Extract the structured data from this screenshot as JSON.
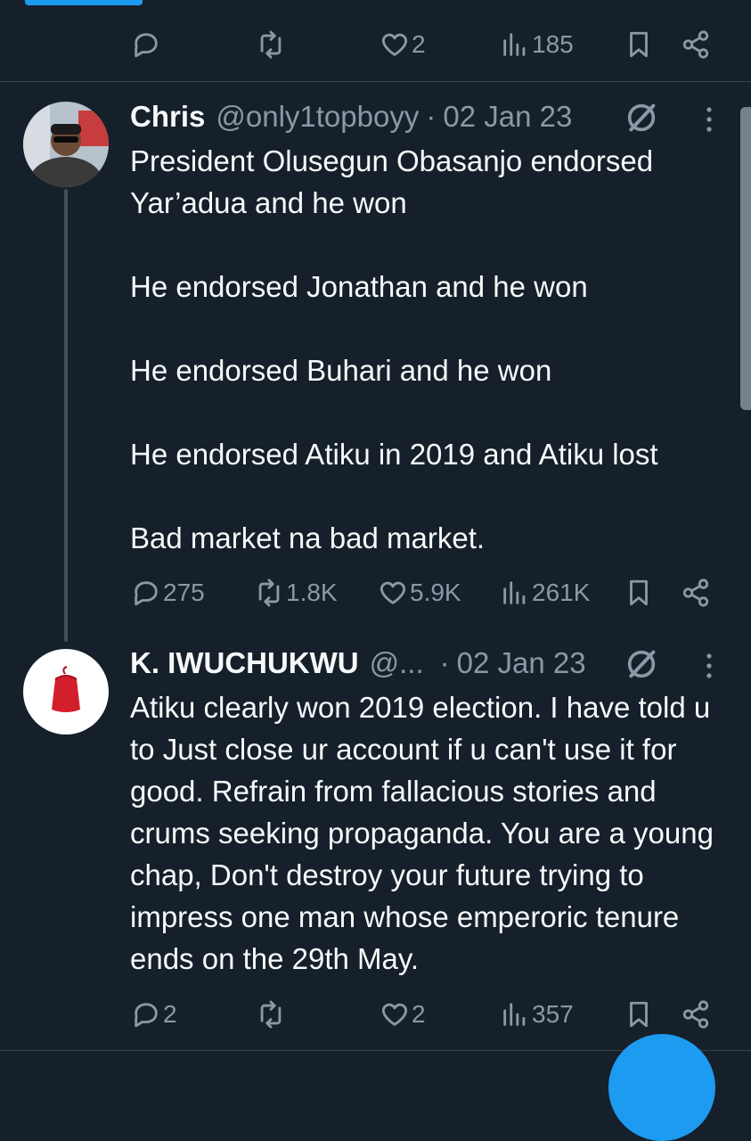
{
  "top_tweet_actions": {
    "reply_count": "",
    "retweet_count": "",
    "like_count": "2",
    "view_count": "185"
  },
  "tweets": [
    {
      "name": "Chris",
      "handle": "@only1topboyy",
      "separator": "·",
      "date": "02 Jan 23",
      "text": "President Olusegun Obasanjo endorsed Yar’adua and he won\n\nHe endorsed Jonathan and he won\n\nHe endorsed Buhari and he won\n\nHe endorsed Atiku in 2019 and Atiku lost\n\nBad market na bad market.",
      "reply_count": "275",
      "retweet_count": "1.8K",
      "like_count": "5.9K",
      "view_count": "261K"
    },
    {
      "name": "K. IWUCHUKWU",
      "handle": "@...",
      "separator": "·",
      "date": "02 Jan 23",
      "text": "Atiku clearly won 2019 election. I have told u to Just close ur account if u can't use it for good. Refrain from fallacious stories and crums seeking propaganda. You are a young chap, Don't destroy your future trying to impress one man whose emperoric tenure ends on the 29th May.",
      "reply_count": "2",
      "retweet_count": "",
      "like_count": "2",
      "view_count": "357"
    }
  ],
  "colors": {
    "background": "#15202b",
    "text_primary": "#f7f9f9",
    "text_secondary": "#8b98a5",
    "accent": "#1d9bf0"
  },
  "icons": [
    "reply-icon",
    "retweet-icon",
    "like-icon",
    "views-icon",
    "bookmark-icon",
    "share-icon",
    "grok-icon",
    "more-icon"
  ]
}
